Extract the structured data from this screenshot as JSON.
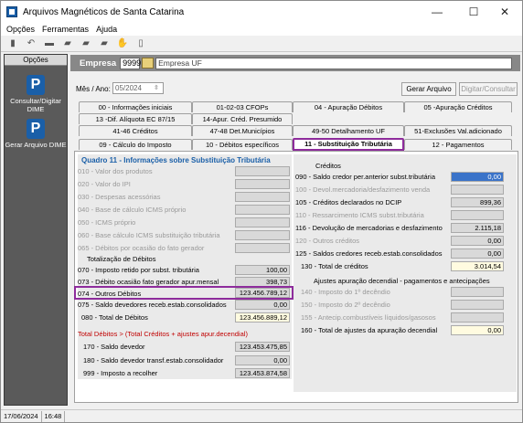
{
  "window": {
    "title": "Arquivos Magnéticos de Santa Catarina",
    "minimize": "—",
    "maximize": "☐",
    "close": "✕"
  },
  "menu": [
    "Opções",
    "Ferramentas",
    "Ajuda"
  ],
  "left_panel": {
    "header": "Opções",
    "items": [
      {
        "label": "Consultar/Digitar DIME"
      },
      {
        "label": "Gerar Arquivo DIME"
      }
    ]
  },
  "empresa": {
    "label": "Empresa",
    "code": "9999",
    "name": "Empresa UF"
  },
  "periodo": {
    "label": "Mês / Ano:",
    "value": "05/2024"
  },
  "buttons": {
    "gerar": "Gerar Arquivo",
    "digitar": "Digitar/Consultar"
  },
  "tabs": {
    "row1": [
      "00 - Informações iniciais",
      "01-02-03   CFOPs",
      "04 - Apuração Débitos",
      "05 -Apuração Créditos"
    ],
    "row2": [
      "13 -Dif. Alíquota EC 87/15",
      "14-Apur. Créd. Presumido"
    ],
    "row3": [
      "41-46   Créditos",
      "47-48  Det.Municípios",
      "49-50  Detalhamento UF",
      "51-Exclusões Val.adicionado"
    ],
    "row4": [
      "09 - Cálculo do Imposto",
      "10 - Débitos específicos",
      "11 - Substituição Tributária",
      "12 - Pagamentos"
    ]
  },
  "quadro_title": "Quadro 11 - Informações sobre Substituição Tributária",
  "left_items": [
    {
      "label": "010 - Valor dos produtos",
      "value": ""
    },
    {
      "label": "020 - Valor do IPI",
      "value": ""
    },
    {
      "label": "030 - Despesas acessórias",
      "value": ""
    },
    {
      "label": "040 - Base de cálculo ICMS próprio",
      "value": ""
    },
    {
      "label": "050 - ICMS próprio",
      "value": ""
    },
    {
      "label": "060 - Base cálculo ICMS substituição tributária",
      "value": ""
    },
    {
      "label": "065 - Débitos por ocasião do fato gerador",
      "value": ""
    }
  ],
  "totalizacao": {
    "header": "Totalização de Débitos",
    "items": [
      {
        "label": "070 - Imposto retido por subst. tributária",
        "value": "100,00"
      },
      {
        "label": "073 - Débito ocasião fato gerador apur.mensal",
        "value": "398,73"
      },
      {
        "label": "074 - Outros Débitos",
        "value": "123.456.789,12"
      },
      {
        "label": "075 - Saldo devedores receb.estab.consolidados",
        "value": "0,00"
      }
    ],
    "total_label": "080 - Total de Débitos",
    "total_value": "123.456.889,12"
  },
  "saldo": {
    "header": "Total Débitos > (Total Créditos + ajustes apur.decendial)",
    "items": [
      {
        "label": "170 - Saldo devedor",
        "value": "123.453.475,85"
      },
      {
        "label": "180 - Saldo devedor transf.estab.consolidador",
        "value": "0,00"
      },
      {
        "label": "999 - Imposto a recolher",
        "value": "123.453.874,58"
      }
    ]
  },
  "creditos": {
    "header": "Créditos",
    "items": [
      {
        "label": "090 - Saldo credor per.anterior subst.tributária",
        "value": "0,00"
      },
      {
        "label": "100 - Devol.mercadoria/desfazimento venda",
        "value": ""
      },
      {
        "label": "105 - Créditos declarados no DCIP",
        "value": "899,36"
      },
      {
        "label": "110 - Ressarcimento ICMS subst.tributária",
        "value": ""
      },
      {
        "label": "116 - Devolução de mercadorias e desfazimento",
        "value": "2.115,18"
      },
      {
        "label": "120 - Outros créditos",
        "value": "0,00"
      },
      {
        "label": "125 - Saldos credores receb.estab.consolidados",
        "value": "0,00"
      }
    ],
    "total_label": "130 - Total de créditos",
    "total_value": "3.014,54"
  },
  "ajustes": {
    "header": "Ajustes apuração decendial - pagamentos e antecipações",
    "items": [
      {
        "label": "140 - Imposto do 1º decêndio",
        "value": ""
      },
      {
        "label": "150 - Imposto do 2º decêndio",
        "value": ""
      },
      {
        "label": "155 - Antecip.combustíveis líquidos/gasosos",
        "value": ""
      }
    ],
    "total_label": "160 - Total de ajustes da apuração decendial",
    "total_value": "0,00"
  },
  "status": {
    "date": "17/06/2024",
    "time": "16:48"
  }
}
